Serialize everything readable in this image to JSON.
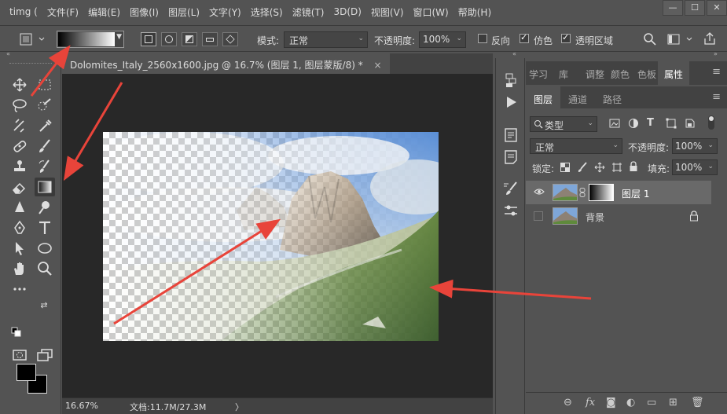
{
  "app": {
    "title": "timg ("
  },
  "menu": [
    "文件(F)",
    "编辑(E)",
    "图像(I)",
    "图层(L)",
    "文字(Y)",
    "选择(S)",
    "滤镜(T)",
    "3D(D)",
    "视图(V)",
    "窗口(W)",
    "帮助(H)"
  ],
  "window_buttons": [
    "—",
    "☐",
    "✕"
  ],
  "options": {
    "mode_label": "模式:",
    "mode_value": "正常",
    "opacity_label": "不透明度:",
    "opacity_value": "100%",
    "reverse_label": "反向",
    "reverse_checked": false,
    "dither_label": "仿色",
    "dither_checked": true,
    "transparency_label": "透明区域",
    "transparency_checked": true
  },
  "document": {
    "tab_title": "Dolomites_Italy_2560x1600.jpg @ 16.7% (图层 1, 图层蒙版/8) *",
    "close": "×",
    "zoom": "16.67%",
    "doc_info": "文档:11.7M/27.3M",
    "status_arrow": "〉"
  },
  "tools": [
    "move-tool",
    "artboard-tool",
    "lasso-tool",
    "quick-selection-tool",
    "crop-tool",
    "eyedropper-tool",
    "healing-brush-tool",
    "brush-tool",
    "clone-stamp-tool",
    "history-brush-tool",
    "eraser-tool",
    "gradient-tool",
    "blur-tool",
    "dodge-tool",
    "pen-tool",
    "type-tool",
    "path-selection-tool",
    "ellipse-tool",
    "hand-tool",
    "zoom-tool"
  ],
  "panel_tabs": [
    "学习",
    "库",
    "调整",
    "颜色",
    "色板",
    "属性"
  ],
  "active_panel_tab": "属性",
  "layer_tabs": [
    "图层",
    "通道",
    "路径"
  ],
  "layers_panel": {
    "filter_label": "类型",
    "blend_mode": "正常",
    "opacity_label": "不透明度:",
    "opacity_value": "100%",
    "lock_label": "锁定:",
    "fill_label": "填充:",
    "fill_value": "100%"
  },
  "layers": [
    {
      "name": "图层 1",
      "visible": true,
      "selected": true,
      "has_mask": true,
      "locked": false
    },
    {
      "name": "背景",
      "visible": false,
      "selected": false,
      "has_mask": false,
      "locked": true
    }
  ],
  "colors": {
    "accent_arrow": "#e8443a",
    "fg_color": "#000000",
    "bg_color": "#000000"
  }
}
